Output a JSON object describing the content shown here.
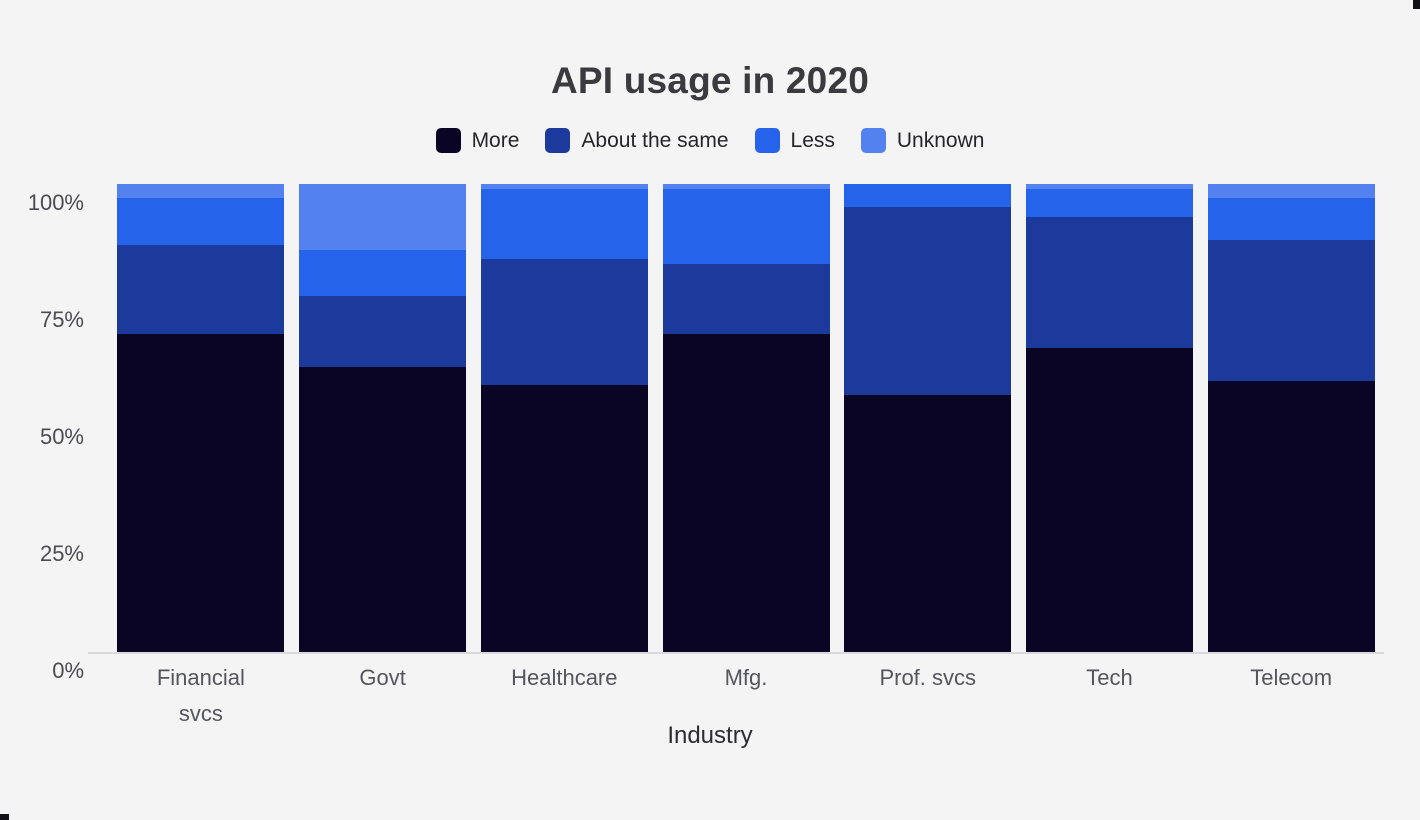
{
  "chart_data": {
    "type": "bar",
    "subtype": "stacked-100-percent",
    "title": "API usage in 2020",
    "xlabel": "Industry",
    "ylabel": "",
    "ylim": [
      0,
      100
    ],
    "ytick_labels": [
      "100%",
      "75%",
      "50%",
      "25%",
      "0%"
    ],
    "ytick_values": [
      100,
      75,
      50,
      25,
      0
    ],
    "grid": false,
    "legend_position": "top",
    "categories": [
      "Financial svcs",
      "Govt",
      "Healthcare",
      "Mfg.",
      "Prof. svcs",
      "Tech",
      "Telecom"
    ],
    "category_lines": [
      [
        "Financial",
        "svcs"
      ],
      [
        "Govt"
      ],
      [
        "Healthcare"
      ],
      [
        "Mfg."
      ],
      [
        "Prof. svcs"
      ],
      [
        "Tech"
      ],
      [
        "Telecom"
      ]
    ],
    "series": [
      {
        "name": "More",
        "color": "#0a0425",
        "values": [
          68,
          61,
          57,
          68,
          55,
          65,
          58
        ]
      },
      {
        "name": "About the same",
        "color": "#1b3a9c",
        "values": [
          19,
          15,
          27,
          15,
          40,
          28,
          30
        ]
      },
      {
        "name": "Less",
        "color": "#2563eb",
        "values": [
          10,
          10,
          15,
          16,
          5,
          6,
          9
        ]
      },
      {
        "name": "Unknown",
        "color": "#5381ef",
        "values": [
          3,
          14,
          1,
          1,
          0,
          1,
          3
        ]
      }
    ]
  },
  "colors": {
    "background": "#f4f4f4",
    "title_text": "#3b3b3f",
    "axis_text": "#55555d",
    "axis_line": "#d9d9dd"
  }
}
